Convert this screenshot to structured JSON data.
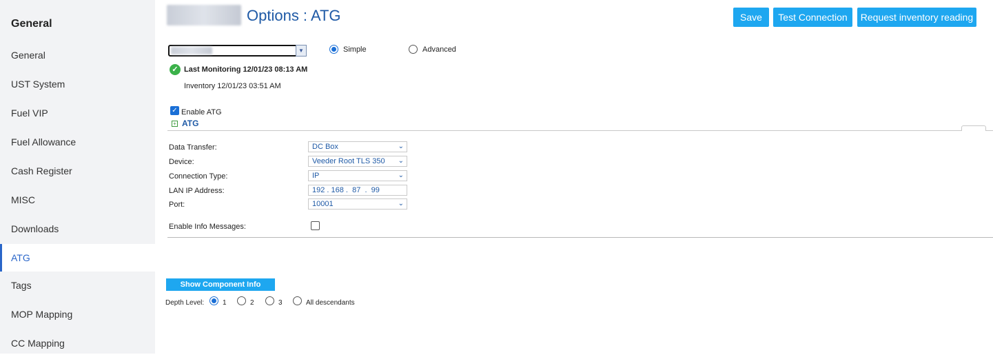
{
  "sidebar": {
    "title": "General",
    "items": [
      {
        "label": "General"
      },
      {
        "label": "UST System"
      },
      {
        "label": "Fuel VIP"
      },
      {
        "label": "Fuel Allowance"
      },
      {
        "label": "Cash Register"
      },
      {
        "label": "MISC"
      },
      {
        "label": "Downloads"
      },
      {
        "label": "ATG"
      },
      {
        "label": "Tags"
      },
      {
        "label": "MOP Mapping"
      },
      {
        "label": "CC Mapping"
      }
    ],
    "active": "ATG"
  },
  "header": {
    "title": "Options : ATG",
    "buttons": {
      "save": "Save",
      "test": "Test Connection",
      "request": "Request inventory reading"
    }
  },
  "mode": {
    "simple_label": "Simple",
    "advanced_label": "Advanced",
    "selected": "Simple"
  },
  "status": {
    "last_monitoring": "Last Monitoring 12/01/23 08:13 AM",
    "inventory": "Inventory 12/01/23 03:51 AM"
  },
  "enable_atg": {
    "label": "Enable ATG",
    "checked": true
  },
  "section": {
    "title": "ATG"
  },
  "form": {
    "data_transfer": {
      "label": "Data Transfer:",
      "value": "DC Box"
    },
    "device": {
      "label": "Device:",
      "value": "Veeder Root TLS 350"
    },
    "connection_type": {
      "label": "Connection Type:",
      "value": "IP"
    },
    "lan_ip": {
      "label": "LAN IP Address:",
      "value": "192 . 168 .  87  .  99"
    },
    "port": {
      "label": "Port:",
      "value": "10001"
    },
    "info_messages": {
      "label": "Enable Info Messages:",
      "checked": false
    }
  },
  "component_info": {
    "button": "Show Component Info",
    "depth_label": "Depth Level:",
    "options": [
      "1",
      "2",
      "3",
      "All descendants"
    ],
    "selected": "1"
  },
  "colors": {
    "accent": "#1ea7f0",
    "title": "#1f5aa6",
    "sidebar_bg": "#f2f3f5",
    "active": "#2a66c9"
  }
}
